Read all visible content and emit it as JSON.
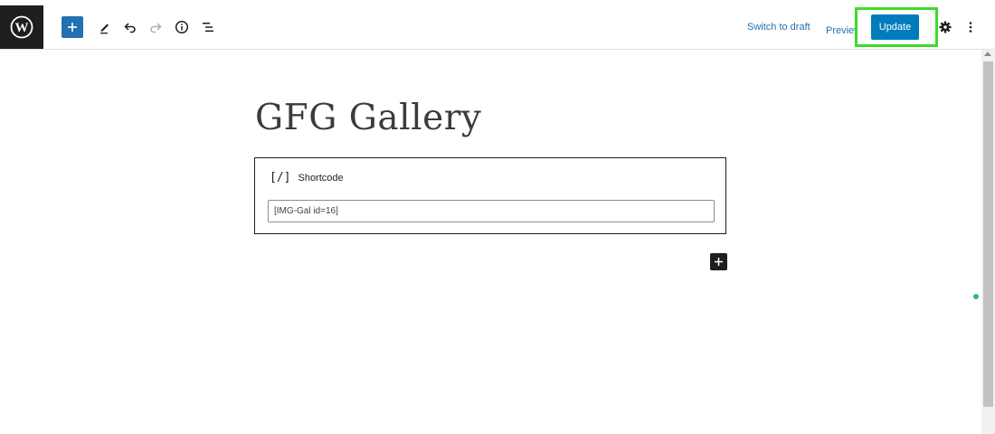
{
  "toolbar": {
    "logo_icon": "wordpress-logo-icon",
    "inserter_icon": "plus-icon",
    "tools_icon": "pencil-icon",
    "undo_icon": "undo-icon",
    "redo_icon": "redo-icon",
    "details_icon": "info-icon",
    "list_view_icon": "list-view-icon",
    "switch_to_draft": "Switch to draft",
    "preview": "Preview",
    "update": "Update",
    "settings_icon": "gear-icon",
    "options_icon": "more-vertical-icon"
  },
  "editor": {
    "title": "GFG Gallery",
    "block": {
      "icon": "[/]",
      "label": "Shortcode",
      "value": "[IMG-Gal id=16]"
    },
    "add_block_icon": "plus-icon"
  },
  "colors": {
    "accent": "#007cba",
    "highlight": "#3cdc2a",
    "dark": "#1e1e1e"
  }
}
